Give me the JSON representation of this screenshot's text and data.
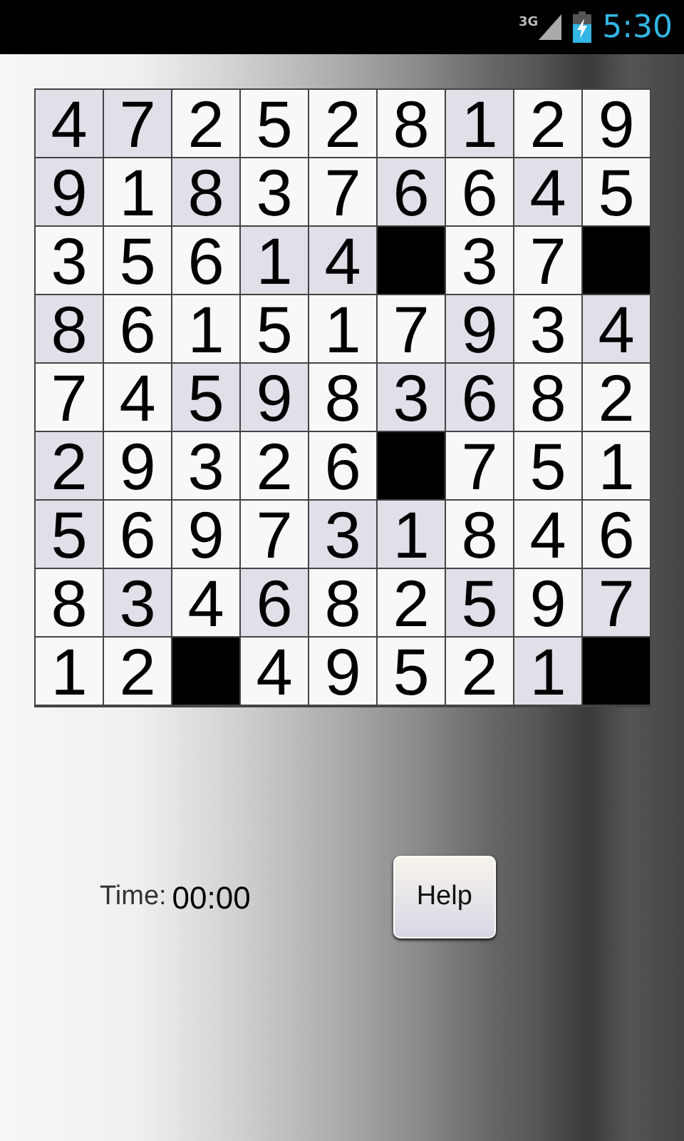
{
  "status_bar": {
    "network": "3G",
    "time": "5:30"
  },
  "grid": {
    "rows": [
      [
        {
          "value": "4",
          "kind": "shaded"
        },
        {
          "value": "7",
          "kind": "shaded"
        },
        {
          "value": "2",
          "kind": "plain"
        },
        {
          "value": "5",
          "kind": "plain"
        },
        {
          "value": "2",
          "kind": "plain"
        },
        {
          "value": "8",
          "kind": "plain"
        },
        {
          "value": "1",
          "kind": "shaded"
        },
        {
          "value": "2",
          "kind": "plain"
        },
        {
          "value": "9",
          "kind": "plain"
        }
      ],
      [
        {
          "value": "9",
          "kind": "shaded"
        },
        {
          "value": "1",
          "kind": "plain"
        },
        {
          "value": "8",
          "kind": "shaded"
        },
        {
          "value": "3",
          "kind": "plain"
        },
        {
          "value": "7",
          "kind": "plain"
        },
        {
          "value": "6",
          "kind": "shaded"
        },
        {
          "value": "6",
          "kind": "plain"
        },
        {
          "value": "4",
          "kind": "shaded"
        },
        {
          "value": "5",
          "kind": "plain"
        }
      ],
      [
        {
          "value": "3",
          "kind": "plain"
        },
        {
          "value": "5",
          "kind": "plain"
        },
        {
          "value": "6",
          "kind": "plain"
        },
        {
          "value": "1",
          "kind": "shaded"
        },
        {
          "value": "4",
          "kind": "shaded"
        },
        {
          "kind": "black"
        },
        {
          "value": "3",
          "kind": "plain"
        },
        {
          "value": "7",
          "kind": "plain"
        },
        {
          "kind": "black"
        }
      ],
      [
        {
          "value": "8",
          "kind": "shaded"
        },
        {
          "value": "6",
          "kind": "plain"
        },
        {
          "value": "1",
          "kind": "plain"
        },
        {
          "value": "5",
          "kind": "plain"
        },
        {
          "value": "1",
          "kind": "plain"
        },
        {
          "value": "7",
          "kind": "plain"
        },
        {
          "value": "9",
          "kind": "shaded"
        },
        {
          "value": "3",
          "kind": "plain"
        },
        {
          "value": "4",
          "kind": "shaded"
        }
      ],
      [
        {
          "value": "7",
          "kind": "plain"
        },
        {
          "value": "4",
          "kind": "plain"
        },
        {
          "value": "5",
          "kind": "shaded"
        },
        {
          "value": "9",
          "kind": "shaded"
        },
        {
          "value": "8",
          "kind": "plain"
        },
        {
          "value": "3",
          "kind": "shaded"
        },
        {
          "value": "6",
          "kind": "shaded"
        },
        {
          "value": "8",
          "kind": "plain"
        },
        {
          "value": "2",
          "kind": "plain"
        }
      ],
      [
        {
          "value": "2",
          "kind": "shaded"
        },
        {
          "value": "9",
          "kind": "plain"
        },
        {
          "value": "3",
          "kind": "plain"
        },
        {
          "value": "2",
          "kind": "plain"
        },
        {
          "value": "6",
          "kind": "plain"
        },
        {
          "kind": "black"
        },
        {
          "value": "7",
          "kind": "plain"
        },
        {
          "value": "5",
          "kind": "plain"
        },
        {
          "value": "1",
          "kind": "plain"
        }
      ],
      [
        {
          "value": "5",
          "kind": "shaded"
        },
        {
          "value": "6",
          "kind": "plain"
        },
        {
          "value": "9",
          "kind": "plain"
        },
        {
          "value": "7",
          "kind": "plain"
        },
        {
          "value": "3",
          "kind": "shaded"
        },
        {
          "value": "1",
          "kind": "shaded"
        },
        {
          "value": "8",
          "kind": "plain"
        },
        {
          "value": "4",
          "kind": "plain"
        },
        {
          "value": "6",
          "kind": "plain"
        }
      ],
      [
        {
          "value": "8",
          "kind": "plain"
        },
        {
          "value": "3",
          "kind": "shaded"
        },
        {
          "value": "4",
          "kind": "plain"
        },
        {
          "value": "6",
          "kind": "shaded"
        },
        {
          "value": "8",
          "kind": "plain"
        },
        {
          "value": "2",
          "kind": "plain"
        },
        {
          "value": "5",
          "kind": "shaded"
        },
        {
          "value": "9",
          "kind": "plain"
        },
        {
          "value": "7",
          "kind": "shaded"
        }
      ],
      [
        {
          "value": "1",
          "kind": "plain"
        },
        {
          "value": "2",
          "kind": "plain"
        },
        {
          "kind": "black"
        },
        {
          "value": "4",
          "kind": "plain"
        },
        {
          "value": "9",
          "kind": "plain"
        },
        {
          "value": "5",
          "kind": "plain"
        },
        {
          "value": "2",
          "kind": "plain"
        },
        {
          "value": "1",
          "kind": "shaded"
        },
        {
          "kind": "black"
        }
      ]
    ]
  },
  "timer": {
    "label": "Time:",
    "value": "00:00"
  },
  "help_button": "Help"
}
